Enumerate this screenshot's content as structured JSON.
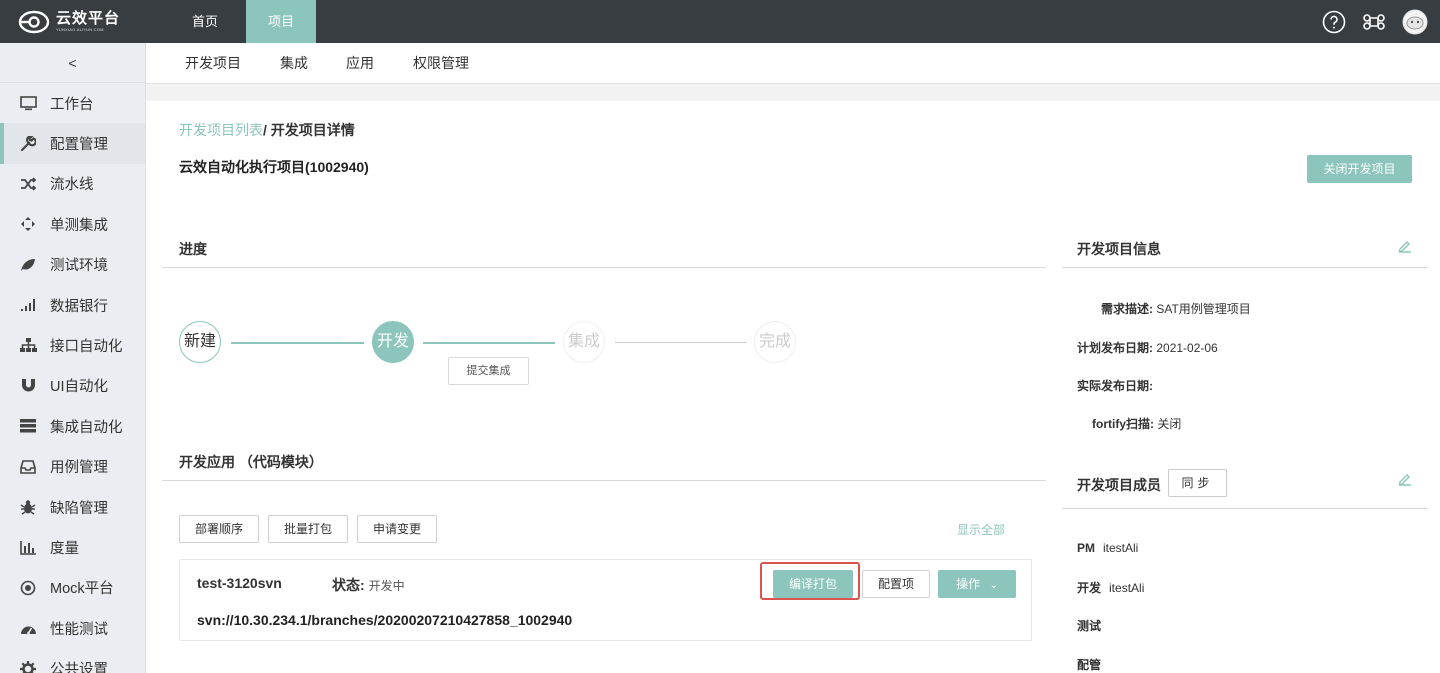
{
  "app": {
    "logo_main": "云效平台",
    "logo_sub": "YUNXIAO.ALIYUN.COM"
  },
  "topnav": {
    "home": "首页",
    "project": "项目"
  },
  "sidebar": {
    "collapse": "<",
    "items": [
      {
        "label": "工作台",
        "icon": "monitor-icon"
      },
      {
        "label": "配置管理",
        "icon": "wrench-icon"
      },
      {
        "label": "流水线",
        "icon": "shuffle-icon"
      },
      {
        "label": "单测集成",
        "icon": "crosshair-icon"
      },
      {
        "label": "测试环境",
        "icon": "leaf-icon"
      },
      {
        "label": "数据银行",
        "icon": "signal-icon"
      },
      {
        "label": "接口自动化",
        "icon": "sitemap-icon"
      },
      {
        "label": "UI自动化",
        "icon": "magnet-icon"
      },
      {
        "label": "集成自动化",
        "icon": "server-icon"
      },
      {
        "label": "用例管理",
        "icon": "inbox-icon"
      },
      {
        "label": "缺陷管理",
        "icon": "bug-icon"
      },
      {
        "label": "度量",
        "icon": "bar-chart-icon"
      },
      {
        "label": "Mock平台",
        "icon": "target-icon"
      },
      {
        "label": "性能测试",
        "icon": "dashboard-icon"
      },
      {
        "label": "公共设置",
        "icon": "gear-icon"
      }
    ]
  },
  "subnav": {
    "items": [
      "开发项目",
      "集成",
      "应用",
      "权限管理"
    ]
  },
  "breadcrumb": {
    "link": "开发项目列表",
    "current": "/ 开发项目详情"
  },
  "project": {
    "title": "云效自动化执行项目(1002940)",
    "close_button": "关闭开发项目"
  },
  "progress": {
    "title": "进度",
    "steps": [
      "新建",
      "开发",
      "集成",
      "完成"
    ],
    "current_step": 1,
    "submit_button": "提交集成"
  },
  "apps": {
    "title": "开发应用 （代码模块）",
    "buttons": [
      "部署顺序",
      "批量打包",
      "申请变更"
    ],
    "show_all": "显示全部",
    "card": {
      "name": "test-3120svn",
      "status_label": "状态:",
      "status_value": "开发中",
      "url": "svn://10.30.234.1/branches/20200207210427858_1002940",
      "build_button": "编译打包",
      "config_button": "配置项",
      "ops_button": "操作"
    }
  },
  "info": {
    "title": "开发项目信息",
    "rows": [
      {
        "label": "需求描述:",
        "value": "SAT用例管理项目"
      },
      {
        "label": "计划发布日期:",
        "value": "2021-02-06"
      },
      {
        "label": "实际发布日期:",
        "value": ""
      },
      {
        "label": "fortify扫描:",
        "value": "关闭"
      }
    ]
  },
  "members": {
    "title": "开发项目成员",
    "sync_button": "同步",
    "rows": [
      {
        "role": "PM",
        "name": "itestAli"
      },
      {
        "role": "开发",
        "name": "itestAli"
      },
      {
        "role": "测试",
        "name": ""
      },
      {
        "role": "配管",
        "name": ""
      }
    ]
  },
  "colors": {
    "accent": "#8cc5bb",
    "topbar": "#373d41",
    "highlight": "#d9534f"
  }
}
